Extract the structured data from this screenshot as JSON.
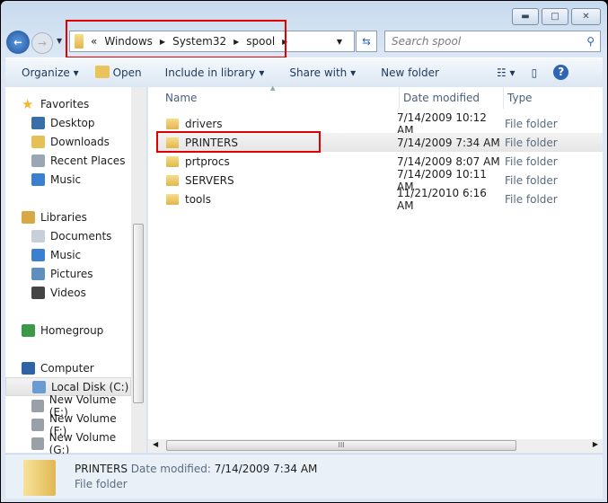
{
  "window": {
    "min": "▬",
    "max": "□",
    "close": "✕"
  },
  "address": {
    "overflow": "«",
    "crumbs": [
      "Windows",
      "System32",
      "spool"
    ]
  },
  "search": {
    "placeholder": "Search spool"
  },
  "toolbar": {
    "organize": "Organize",
    "open": "Open",
    "include": "Include in library",
    "share": "Share with",
    "new_folder": "New folder"
  },
  "nav": {
    "items": [
      {
        "label": "Favorites",
        "icon": "star-icon",
        "color": "#f2b632"
      },
      {
        "label": "Desktop",
        "icon": "desktop-icon",
        "color": "#3a6ea8"
      },
      {
        "label": "Downloads",
        "icon": "downloads-icon",
        "color": "#e6bf55"
      },
      {
        "label": "Recent Places",
        "icon": "recent-places-icon",
        "color": "#9aa6b3"
      },
      {
        "label": "Music",
        "icon": "music-icon",
        "color": "#3b7fd1"
      },
      {
        "label": "Libraries",
        "icon": "libraries-icon",
        "color": "#d8a845"
      },
      {
        "label": "Documents",
        "icon": "documents-icon",
        "color": "#c8cfd8"
      },
      {
        "label": "Music",
        "icon": "music-icon",
        "color": "#3b7fd1"
      },
      {
        "label": "Pictures",
        "icon": "pictures-icon",
        "color": "#5e8fbf"
      },
      {
        "label": "Videos",
        "icon": "videos-icon",
        "color": "#444"
      },
      {
        "label": "Homegroup",
        "icon": "homegroup-icon",
        "color": "#3a9a4a"
      },
      {
        "label": "Computer",
        "icon": "computer-icon",
        "color": "#2f62a7"
      },
      {
        "label": "Local Disk (C:)",
        "icon": "local-disk-icon",
        "color": "#6a9bd1"
      },
      {
        "label": "New Volume (E:)",
        "icon": "drive-icon",
        "color": "#9aa0a8"
      },
      {
        "label": "New Volume (F:)",
        "icon": "drive-icon",
        "color": "#9aa0a8"
      },
      {
        "label": "New Volume (G:)",
        "icon": "drive-icon",
        "color": "#9aa0a8"
      }
    ]
  },
  "columns": {
    "name": "Name",
    "date": "Date modified",
    "type": "Type"
  },
  "files": [
    {
      "name": "drivers",
      "date": "7/14/2009 10:12 AM",
      "type": "File folder"
    },
    {
      "name": "PRINTERS",
      "date": "7/14/2009 7:34 AM",
      "type": "File folder"
    },
    {
      "name": "prtprocs",
      "date": "7/14/2009 8:07 AM",
      "type": "File folder"
    },
    {
      "name": "SERVERS",
      "date": "7/14/2009 10:11 AM",
      "type": "File folder"
    },
    {
      "name": "tools",
      "date": "11/21/2010 6:16 AM",
      "type": "File folder"
    }
  ],
  "details": {
    "name": "PRINTERS",
    "date_label": "Date modified:",
    "date": "7/14/2009 7:34 AM",
    "type": "File folder"
  },
  "highlight_color": "#e00000"
}
